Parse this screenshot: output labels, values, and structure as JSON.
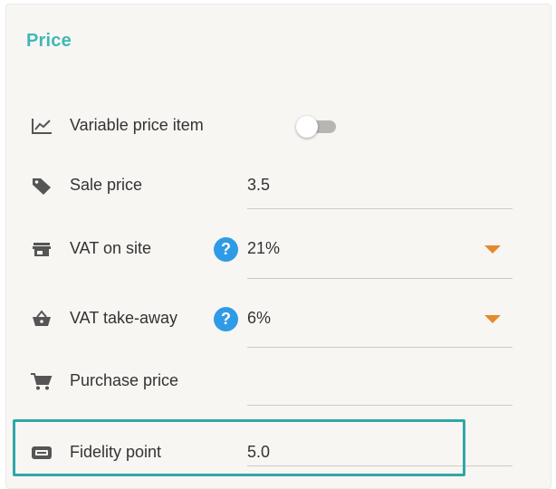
{
  "section": {
    "title": "Price"
  },
  "fields": {
    "variable_price": {
      "label": "Variable price item",
      "icon": "line-chart-icon",
      "enabled": false
    },
    "sale_price": {
      "label": "Sale price",
      "icon": "tag-icon",
      "value": "3.5"
    },
    "vat_on_site": {
      "label": "VAT on site",
      "icon": "store-icon",
      "help": "?",
      "value": "21%"
    },
    "vat_take_away": {
      "label": "VAT take-away",
      "icon": "basket-icon",
      "help": "?",
      "value": "6%"
    },
    "purchase_price": {
      "label": "Purchase price",
      "icon": "cart-icon",
      "value": ""
    },
    "fidelity_point": {
      "label": "Fidelity point",
      "icon": "card-icon",
      "value": "5.0"
    }
  },
  "colors": {
    "accent": "#3fb8b8",
    "help_badge": "#2f9be6",
    "caret": "#e58a2e",
    "highlight_border": "#2fa7a7"
  }
}
